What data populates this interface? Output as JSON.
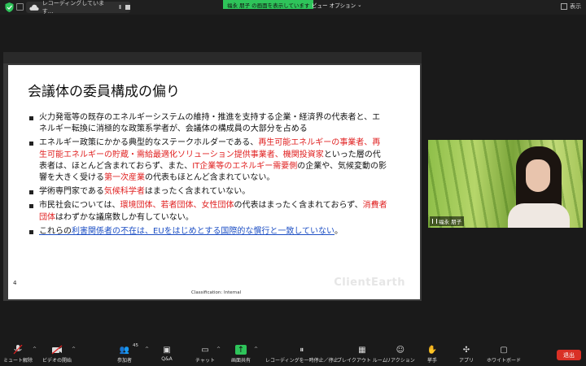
{
  "topbar": {
    "recording_status": "レコーディングしています...",
    "pause_glyph": "II",
    "share_banner": "福永 朋子 の画面を表示しています",
    "view_options": "ビュー オプション",
    "view_options_caret": "⌄",
    "display_label": "表示"
  },
  "slide": {
    "title": "会議体の委員構成の偏り",
    "page_number": "4",
    "classification": "Classification: Internal",
    "watermark": "ClientEarth",
    "b1": "火力発電等の既存のエネルギーシステムの維持・推進を支持する企業・経済界の代表者と、エネルギー転換に消極的な政策系学者が、会議体の構成員の大部分を占める",
    "b2_a": "エネルギー政策にかかる典型的なステークホルダーである、",
    "b2_r1": "再生可能エネルギーの事業者、再生可能エネルギーの貯蔵・需給最適化ソリューション提供事業者、機関投資家",
    "b2_b": "といった層の代表者は、ほとんど含まれておらず、また、",
    "b2_r2": "IT企業等のエネルギー需要側",
    "b2_c": "の企業や、気候変動の影響を大きく受ける",
    "b2_r3": "第一次産業",
    "b2_d": "の代表もほとんど含まれていない。",
    "b3_a": "学術専門家である",
    "b3_r": "気候科学者",
    "b3_b": "はまったく含まれていない。",
    "b4_a": "市民社会については、",
    "b4_r1": "環境団体、若者団体、女性団体",
    "b4_b": "の代表はまったく含まれておらず、",
    "b4_r2": "消費者団体",
    "b4_c": "はわずかな議席数しか有していない。",
    "b5_k1": "これらの",
    "b5_u": "利害関係者の不在は、EUをはじめとする国際的な慣行と一致していない",
    "b5_k2": "。"
  },
  "video": {
    "participant_name": "福永 朋子"
  },
  "toolbar": {
    "mute": "ミュート解除",
    "video": "ビデオの開始",
    "participants": "参加者",
    "participant_count": "45",
    "qa": "Q&A",
    "chat": "チャット",
    "share": "画面共有",
    "pause_recording": "レコーディングを一時停止／停止",
    "breakout": "ブレイクアウト ルーム",
    "reactions": "リアクション",
    "raise_hand": "挙手",
    "apps": "アプリ",
    "whiteboard": "ホワイトボード",
    "leave": "退出"
  },
  "colors": {
    "accent_green": "#2ec45a",
    "leave_red": "#d93025",
    "slide_red": "#e02020",
    "slide_blue": "#1d4fc4"
  },
  "icons": {
    "security": "shield-icon",
    "recording": "cloud-icon",
    "mute": "microphone-muted-icon",
    "video": "camera-off-icon",
    "participants": "people-icon",
    "qa": "qa-icon",
    "chat": "chat-bubble-icon",
    "share": "share-arrow-icon",
    "pause_recording": "pause-stop-icon",
    "breakout": "grid-icon",
    "reactions": "smiley-icon",
    "raise_hand": "hand-icon",
    "apps": "apps-icon",
    "whiteboard": "whiteboard-icon"
  }
}
